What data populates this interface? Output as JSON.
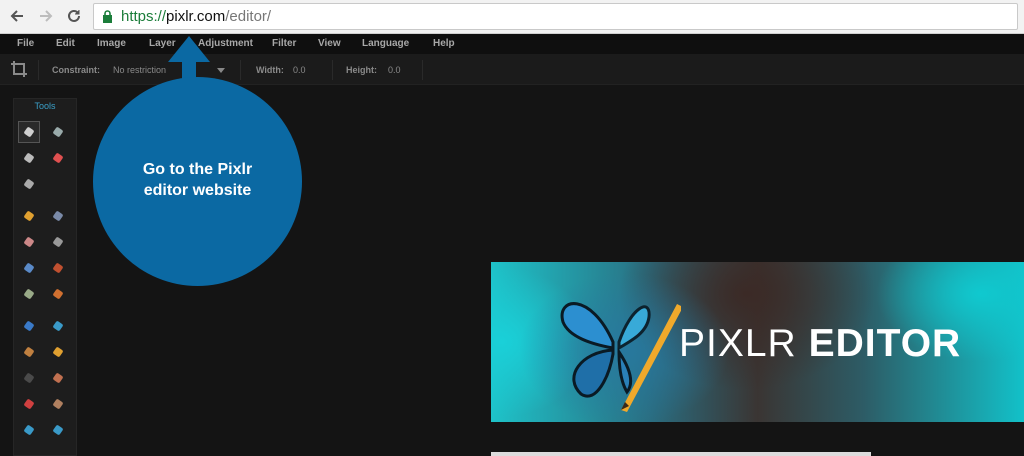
{
  "browser": {
    "url_protocol": "https://",
    "url_host": "pixlr.com",
    "url_path": "/editor/"
  },
  "menu": {
    "items": [
      "File",
      "Edit",
      "Image",
      "Layer",
      "Adjustment",
      "Filter",
      "View",
      "Language",
      "Help"
    ]
  },
  "options_bar": {
    "constraint_label": "Constraint:",
    "constraint_value": "No restriction",
    "width_label": "Width:",
    "width_value": "0.0",
    "height_label": "Height:",
    "height_value": "0.0"
  },
  "tools": {
    "title": "Tools",
    "icons": [
      "crop-tool-icon",
      "move-tool-icon",
      "marquee-tool-icon",
      "lasso-tool-icon",
      "magic-wand-tool-icon",
      "pencil-tool-icon",
      "brush-tool-icon",
      "eraser-tool-icon",
      "paint-bucket-tool-icon",
      "gradient-tool-icon",
      "clone-stamp-tool-icon",
      "color-replace-tool-icon",
      "drawing-tool-icon",
      "blur-tool-icon",
      "sharpen-tool-icon",
      "smudge-tool-icon",
      "sponge-tool-icon",
      "dodge-tool-icon",
      "burn-tool-icon",
      "red-eye-tool-icon",
      "spot-heal-tool-icon",
      "bloat-tool-icon",
      "pinch-tool-icon"
    ]
  },
  "splash": {
    "title_thin": "PIXLR ",
    "title_bold": "EDITOR"
  },
  "callout": {
    "line1": "Go to the Pixlr",
    "line2": "editor website"
  },
  "colors": {
    "callout": "#0b69a3",
    "tools_title": "#3aa0c9",
    "secure_green": "#1b7d3a"
  }
}
